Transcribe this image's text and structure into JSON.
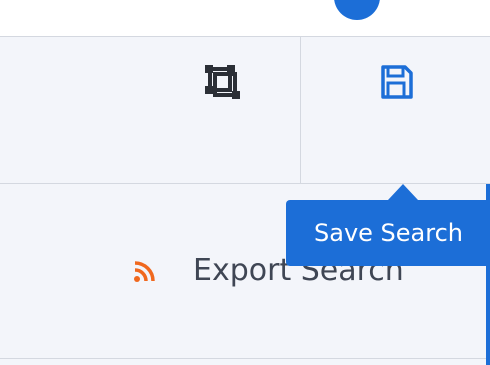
{
  "toolbar": {
    "crop_icon": "crop-icon",
    "save_icon": "floppy-disk-icon"
  },
  "tooltip": {
    "text": "Save Search"
  },
  "menu": {
    "items": [
      {
        "label": "Export Search",
        "icon": "rss-icon"
      }
    ]
  },
  "colors": {
    "accent": "#1c6ed7",
    "rss": "#f0681e",
    "text": "#3f4654",
    "panel": "#f3f5fa"
  }
}
